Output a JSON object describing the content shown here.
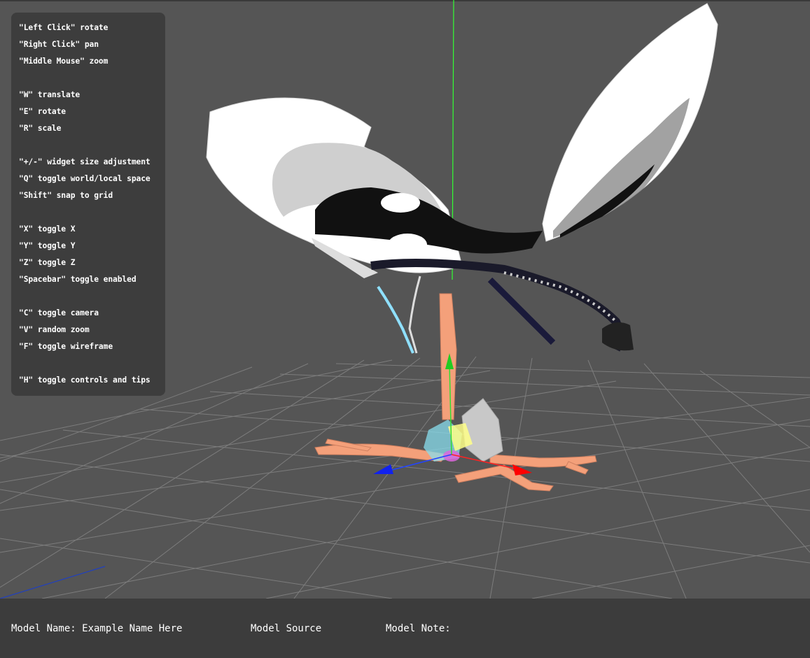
{
  "controls": {
    "groups": [
      [
        "\"Left Click\" rotate",
        "\"Right Click\" pan",
        "\"Middle Mouse\" zoom"
      ],
      [
        "\"W\" translate",
        "\"E\" rotate",
        "\"R\" scale"
      ],
      [
        "\"+/-\" widget size adjustment",
        "\"Q\" toggle world/local space",
        "\"Shift\" snap to grid"
      ],
      [
        "\"X\" toggle X",
        "\"Y\" toggle Y",
        "\"Z\" toggle Z",
        "\"Spacebar\" toggle enabled"
      ],
      [
        "\"C\" toggle camera",
        "\"V\" random zoom",
        "\"F\" toggle wireframe"
      ],
      [
        "\"H\" toggle controls and tips"
      ]
    ]
  },
  "info_bar": {
    "model_name": "Model Name: Example Name Here",
    "model_source": "Model Source",
    "model_note": "Model Note:"
  },
  "scene": {
    "background_color": "#555555",
    "grid_color": "#8a8a8a",
    "axis_colors": {
      "x": "#ff0000",
      "y": "#00ff00",
      "z": "#0000ff"
    },
    "model_colors": {
      "branch": "#f4a07a",
      "wing": "#ffffff",
      "crystal": "#c8c8c8"
    }
  }
}
